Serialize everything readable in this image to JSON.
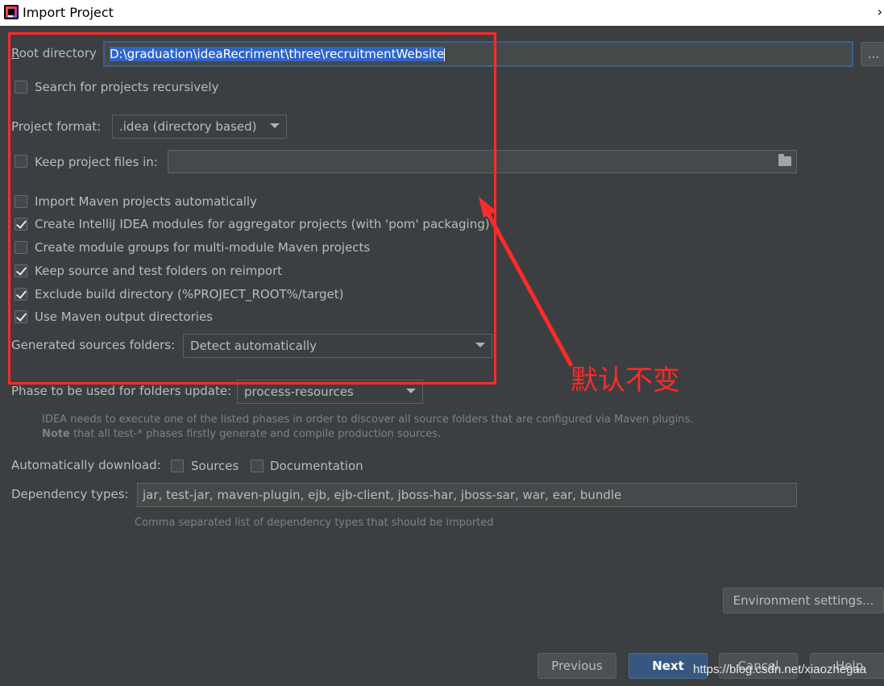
{
  "window": {
    "title": "Import Project",
    "close_glyph": "›"
  },
  "root_directory": {
    "label": "Root directory",
    "value": "D:\\graduation\\ideaRecriment\\three\\recruitmentWebsite",
    "browse_label": "..."
  },
  "search_recursively": {
    "label": "Search for projects recursively",
    "checked": false
  },
  "project_format": {
    "label": "Project format:",
    "value": ".idea (directory based)"
  },
  "keep_project_files": {
    "label": "Keep project files in:",
    "checked": false,
    "value": ""
  },
  "options": [
    {
      "label": "Import Maven projects automatically",
      "checked": false
    },
    {
      "label": "Create IntelliJ IDEA modules for aggregator projects (with 'pom' packaging)",
      "checked": true
    },
    {
      "label": "Create module groups for multi-module Maven projects",
      "checked": false
    },
    {
      "label": "Keep source and test folders on reimport",
      "checked": true
    },
    {
      "label": "Exclude build directory (%PROJECT_ROOT%/target)",
      "checked": true
    },
    {
      "label": "Use Maven output directories",
      "checked": true
    }
  ],
  "generated_sources": {
    "label": "Generated sources folders:",
    "value": "Detect automatically"
  },
  "phase": {
    "label": "Phase to be used for folders update:",
    "value": "process-resources",
    "hint_line1": "IDEA needs to execute one of the listed phases in order to discover all source folders that are configured via Maven plugins.",
    "hint_note_bold": "Note",
    "hint_line2": " that all test-* phases firstly generate and compile production sources."
  },
  "auto_download": {
    "label": "Automatically download:",
    "sources_label": "Sources",
    "sources_checked": false,
    "docs_label": "Documentation",
    "docs_checked": false
  },
  "dependency_types": {
    "label": "Dependency types:",
    "value": "jar, test-jar, maven-plugin, ejb, ejb-client, jboss-har, jboss-sar, war, ear, bundle",
    "hint": "Comma separated list of dependency types that should be imported"
  },
  "buttons": {
    "environment": "Environment settings...",
    "previous": "Previous",
    "next": "Next",
    "cancel": "Cancel",
    "help": "Help"
  },
  "annotation": {
    "text": "默认不变",
    "color": "#ff2a2a"
  },
  "watermark": "https://blog.csdn.net/xiaozhegaa"
}
